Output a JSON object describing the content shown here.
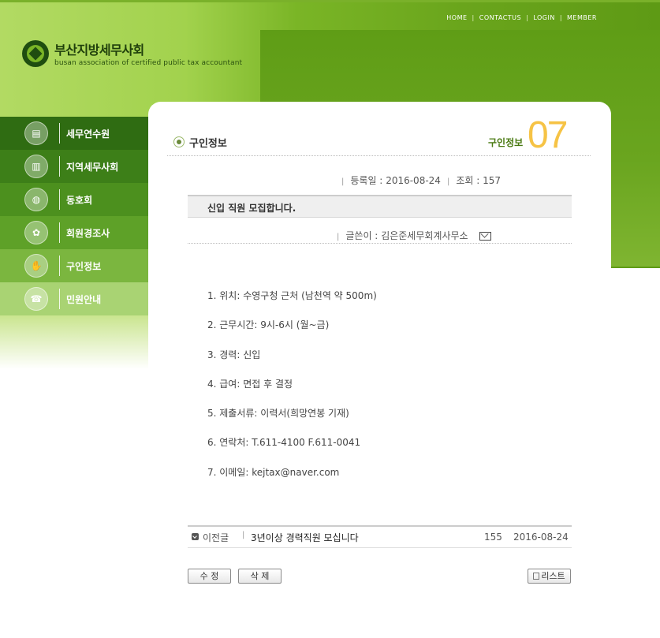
{
  "top_nav": {
    "items": [
      "HOME",
      "CONTACTUS",
      "LOGIN",
      "MEMBER"
    ]
  },
  "logo": {
    "name_ko": "부산지방세무사회",
    "name_en": "busan association of certified public tax accountant"
  },
  "sidebar": {
    "items": [
      {
        "label": "세무연수원",
        "icon": "book-icon",
        "color": "#2f6c12"
      },
      {
        "label": "지역세무사회",
        "icon": "buildings-icon",
        "color": "#3d7f18"
      },
      {
        "label": "동호회",
        "icon": "tennis-icon",
        "color": "#4c901e"
      },
      {
        "label": "회원경조사",
        "icon": "flower-icon",
        "color": "#5ea128"
      },
      {
        "label": "구인정보",
        "icon": "handshake-icon",
        "color": "#7bb63f"
      },
      {
        "label": "민원안내",
        "icon": "phone-icon",
        "color": "#a9d373"
      }
    ]
  },
  "page": {
    "title": "구인정보",
    "section_label": "구인정보",
    "section_number": "07"
  },
  "post": {
    "date_label": "등록일 :",
    "date": "2016-08-24",
    "views_label": "조회 :",
    "views": "157",
    "title": "신입 직원 모집합니다.",
    "author_label": "글쓴이 :",
    "author": "김은준세무회계사무소",
    "body": [
      "1. 위치: 수영구청 근처 (남천역 약 500m)",
      "2. 근무시간: 9시-6시 (월~금)",
      "3. 경력: 신입",
      "4. 급여: 면접 후 결정",
      "5. 제출서류: 이력서(희망연봉 기재)",
      "6. 연락처: T.611-4100 F.611-0041",
      "7. 이메일: kejtax@naver.com"
    ]
  },
  "prev_post": {
    "label": "이전글",
    "title": "3년이상 경력직원 모십니다",
    "views": "155",
    "date": "2016-08-24"
  },
  "buttons": {
    "edit": "수 정",
    "delete": "삭 제",
    "list": "리스트"
  },
  "colors": {
    "brand_green": "#6aa51c",
    "accent_yellow": "#f6c345"
  }
}
